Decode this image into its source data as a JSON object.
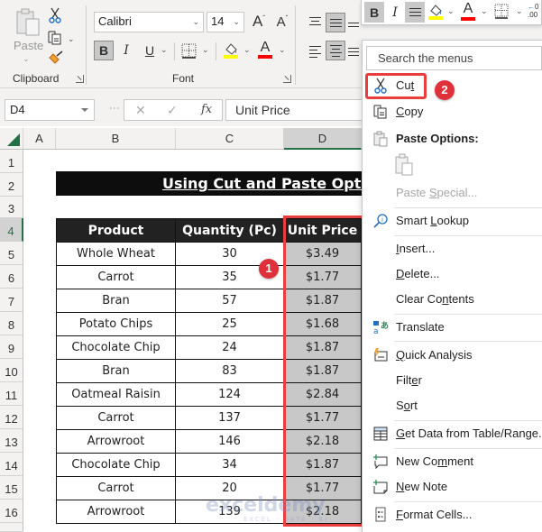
{
  "ribbon": {
    "clipboard": {
      "paste_label": "Paste",
      "group_label": "Clipboard",
      "icons": [
        "paste-icon",
        "cut-icon",
        "copy-icon",
        "format-painter-icon"
      ]
    },
    "font": {
      "font_name": "Calibri",
      "font_size": "14",
      "group_label": "Font",
      "bold": "B",
      "italic": "I",
      "underline": "U",
      "grow": "A",
      "shrink": "A",
      "font_color_letter": "A",
      "highlight_color": "#ffff00",
      "font_color": "#ff0000"
    }
  },
  "formula_bar": {
    "name_box": "D4",
    "cancel": "✕",
    "enter": "✓",
    "fx": "fx",
    "value": "Unit Price"
  },
  "grid": {
    "columns": [
      "A",
      "B",
      "C",
      "D"
    ],
    "selected_column": "D",
    "rows": [
      "1",
      "2",
      "3",
      "4",
      "5",
      "6",
      "7",
      "8",
      "9",
      "10",
      "11",
      "12",
      "13",
      "14",
      "15",
      "16"
    ],
    "selected_row": "4",
    "title": "Using Cut and Paste Optio",
    "table": {
      "headers": [
        "Product",
        "Quantity (Pc)",
        "Unit Price"
      ],
      "rows": [
        [
          "Whole Wheat",
          "30",
          "$3.49"
        ],
        [
          "Carrot",
          "35",
          "$1.77"
        ],
        [
          "Bran",
          "57",
          "$1.87"
        ],
        [
          "Potato Chips",
          "25",
          "$1.68"
        ],
        [
          "Chocolate Chip",
          "24",
          "$1.87"
        ],
        [
          "Bran",
          "83",
          "$1.87"
        ],
        [
          "Oatmeal Raisin",
          "124",
          "$2.84"
        ],
        [
          "Carrot",
          "137",
          "$1.77"
        ],
        [
          "Arrowroot",
          "146",
          "$2.18"
        ],
        [
          "Chocolate Chip",
          "34",
          "$1.87"
        ],
        [
          "Carrot",
          "20",
          "$1.77"
        ],
        [
          "Arrowroot",
          "139",
          "$2.18"
        ]
      ]
    }
  },
  "annotations": {
    "badge1": "1",
    "badge2": "2",
    "highlight_color": "#e83e3e"
  },
  "watermark": {
    "main": "exceldemy",
    "sub": "EXCEL · DATA · BI"
  },
  "mini_toolbar": {
    "bold": "B",
    "italic": "I",
    "font_color_letter": "A",
    "decimal": "←0 .00"
  },
  "context_menu": {
    "search_placeholder": "Search the menus",
    "items": {
      "cut": {
        "pre": "Cu",
        "u": "t",
        "post": ""
      },
      "copy": {
        "pre": "",
        "u": "C",
        "post": "opy"
      },
      "paste_options": "Paste Options:",
      "paste_special": {
        "pre": "Paste ",
        "u": "S",
        "post": "pecial..."
      },
      "smart_lookup": {
        "pre": "Smart ",
        "u": "L",
        "post": "ookup"
      },
      "insert": {
        "pre": "",
        "u": "I",
        "post": "nsert..."
      },
      "delete": {
        "pre": "",
        "u": "D",
        "post": "elete..."
      },
      "clear_contents": {
        "pre": "Clear Co",
        "u": "n",
        "post": "tents"
      },
      "translate": {
        "pre": "Translate",
        "u": "",
        "post": ""
      },
      "quick_analysis": {
        "pre": "",
        "u": "Q",
        "post": "uick Analysis"
      },
      "filter": {
        "pre": "Filt",
        "u": "e",
        "post": "r"
      },
      "sort": {
        "pre": "S",
        "u": "o",
        "post": "rt"
      },
      "get_data": {
        "pre": "",
        "u": "G",
        "post": "et Data from Table/Range..."
      },
      "new_comment": {
        "pre": "New Co",
        "u": "m",
        "post": "ment"
      },
      "new_note": {
        "pre": "",
        "u": "N",
        "post": "ew Note"
      },
      "format_cells": {
        "pre": "",
        "u": "F",
        "post": "ormat Cells..."
      }
    }
  }
}
